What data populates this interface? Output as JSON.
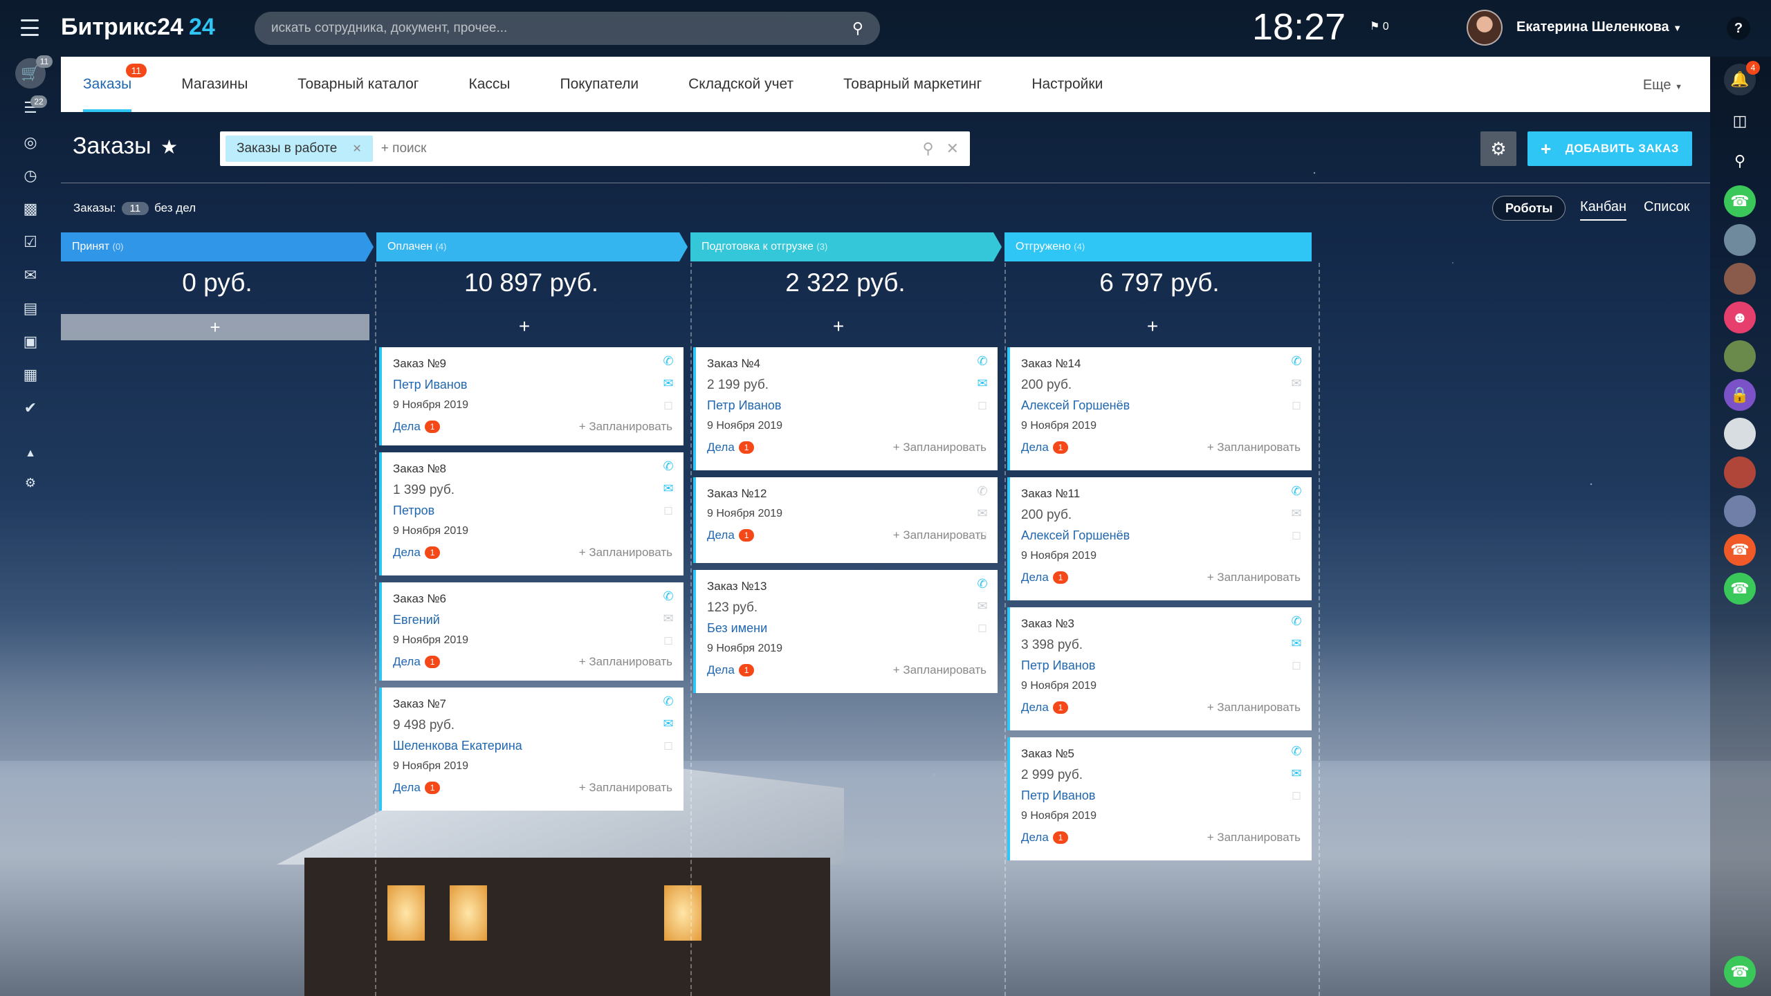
{
  "header": {
    "logo_text": "Битрикс24",
    "logo_num": "24",
    "search_placeholder": "искать сотрудника, документ, прочее...",
    "clock": "18:27",
    "flag_count": "0",
    "username": "Екатерина Шеленкова"
  },
  "leftbar": {
    "badges": {
      "cart": "11",
      "funnel": "22"
    }
  },
  "rightbar": {
    "bell_badge": "4"
  },
  "tabs": {
    "items": [
      "Заказы",
      "Магазины",
      "Товарный каталог",
      "Кассы",
      "Покупатели",
      "Складской учет",
      "Товарный маркетинг",
      "Настройки"
    ],
    "active_badge": "11",
    "more": "Еще"
  },
  "toolbar": {
    "title": "Заказы",
    "filter_chip": "Заказы в работе",
    "search_placeholder": "+ поиск",
    "add_button": "ДОБАВИТЬ ЗАКАЗ"
  },
  "summary": {
    "label": "Заказы:",
    "count": "11",
    "suffix": "без дел",
    "robots": "Роботы",
    "view_kanban": "Канбан",
    "view_list": "Список"
  },
  "colors": {
    "accent": "#2fc6f6",
    "link": "#2067b0",
    "badge": "#f54819",
    "col1": "#2f96e8",
    "col2": "#35b5ef",
    "col3": "#33c7d9",
    "col4": "#2fc6f6"
  },
  "columns": [
    {
      "name": "Принят",
      "count": "(0)",
      "sum": "0 руб.",
      "plus": "+"
    },
    {
      "name": "Оплачен",
      "count": "(4)",
      "sum": "10 897 руб.",
      "plus": "+"
    },
    {
      "name": "Подготовка к отгрузке",
      "count": "(3)",
      "sum": "2 322 руб.",
      "plus": "+"
    },
    {
      "name": "Отгружено",
      "count": "(4)",
      "sum": "6 797 руб.",
      "plus": "+"
    }
  ],
  "cards": {
    "c9": {
      "title": "Заказ №9",
      "price": "",
      "client": "Петр Иванов",
      "date": "9 Ноября 2019"
    },
    "c8": {
      "title": "Заказ №8",
      "price": "1 399 руб.",
      "client": "Петров",
      "date": "9 Ноября 2019"
    },
    "c6": {
      "title": "Заказ №6",
      "price": "",
      "client": "Евгений",
      "date": "9 Ноября 2019"
    },
    "c7": {
      "title": "Заказ №7",
      "price": "9 498 руб.",
      "client": "Шеленкова Екатерина",
      "date": "9 Ноября 2019"
    },
    "c4": {
      "title": "Заказ №4",
      "price": "2 199 руб.",
      "client": "Петр Иванов",
      "date": "9 Ноября 2019"
    },
    "c12": {
      "title": "Заказ №12",
      "price": "",
      "client": "",
      "date": "9 Ноября 2019"
    },
    "c13": {
      "title": "Заказ №13",
      "price": "123 руб.",
      "client": "Без имени",
      "date": "9 Ноября 2019"
    },
    "c14": {
      "title": "Заказ №14",
      "price": "200 руб.",
      "client": "Алексей Горшенёв",
      "date": "9 Ноября 2019"
    },
    "c11": {
      "title": "Заказ №11",
      "price": "200 руб.",
      "client": "Алексей Горшенёв",
      "date": "9 Ноября 2019"
    },
    "c3": {
      "title": "Заказ №3",
      "price": "3 398 руб.",
      "client": "Петр Иванов",
      "date": "9 Ноября 2019"
    },
    "c5": {
      "title": "Заказ №5",
      "price": "2 999 руб.",
      "client": "Петр Иванов",
      "date": "9 Ноября 2019"
    }
  },
  "card_common": {
    "deals": "Дела",
    "deals_count": "1",
    "plan": "+ Запланировать"
  }
}
